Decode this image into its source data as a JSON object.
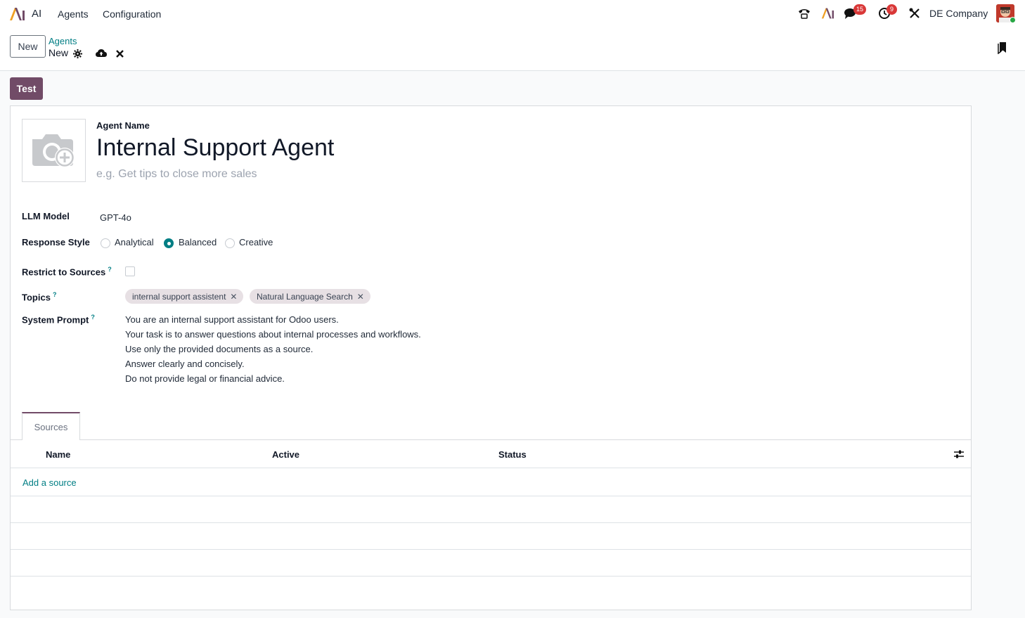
{
  "navbar": {
    "app_name": "AI",
    "menu": [
      "Agents",
      "Configuration"
    ],
    "icons": [
      "phone-icon",
      "ai-icon",
      "messages-icon",
      "activity-clock-icon",
      "tools-icon"
    ],
    "messages_badge": "15",
    "activities_badge": "9",
    "company": "DE Company"
  },
  "control": {
    "new_label": "New",
    "breadcrumb_parent": "Agents",
    "breadcrumb_current": "New"
  },
  "form": {
    "test_label": "Test",
    "name_label": "Agent Name",
    "name_value": "Internal Support Agent",
    "description_placeholder": "e.g. Get tips to close more sales",
    "llm_model_label": "LLM Model",
    "llm_model_value": "GPT-4o",
    "response_style_label": "Response Style",
    "response_styles": [
      "Analytical",
      "Balanced",
      "Creative"
    ],
    "response_style_selected": "Balanced",
    "restrict_label": "Restrict to Sources",
    "restrict_checked": false,
    "topics_label": "Topics",
    "topics": [
      "internal support assistent",
      "Natural Language Search"
    ],
    "system_prompt_label": "System Prompt",
    "system_prompt_lines": [
      "You are an internal support assistant for Odoo users.",
      "Your task is to answer questions about internal processes and workflows.",
      "Use only the provided documents as a source.",
      "Answer clearly and concisely.",
      "Do not provide legal or financial advice."
    ],
    "help_marker": "?"
  },
  "notebook": {
    "tab_label": "Sources",
    "columns": [
      "Name",
      "Active",
      "Status"
    ],
    "add_line_label": "Add a source"
  },
  "colors": {
    "brand": "#714b67",
    "link": "#017e84",
    "badge": "#d93838"
  }
}
